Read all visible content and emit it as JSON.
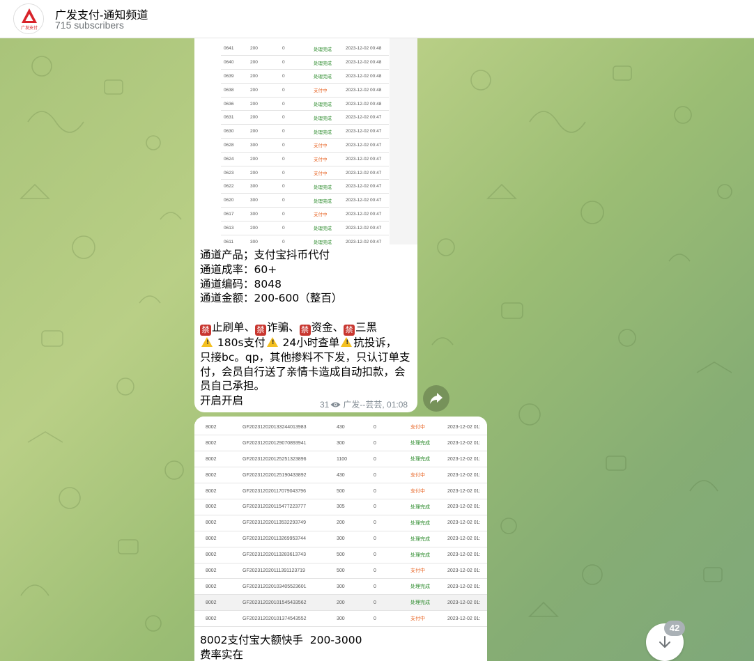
{
  "header": {
    "title": "广发支付-通知频道",
    "subscribers": "715 subscribers",
    "avatar_text": "广发支付"
  },
  "message1": {
    "table": [
      [
        "0641",
        "200",
        "0",
        "处理完成",
        "2023-12-02 00:48"
      ],
      [
        "0640",
        "200",
        "0",
        "处理完成",
        "2023-12-02 00:48"
      ],
      [
        "0639",
        "200",
        "0",
        "处理完成",
        "2023-12-02 00:48"
      ],
      [
        "0638",
        "200",
        "0",
        "支付中",
        "2023-12-02 00:48"
      ],
      [
        "0636",
        "200",
        "0",
        "处理完成",
        "2023-12-02 00:48"
      ],
      [
        "0631",
        "200",
        "0",
        "处理完成",
        "2023-12-02 00:47"
      ],
      [
        "0630",
        "200",
        "0",
        "处理完成",
        "2023-12-02 00:47"
      ],
      [
        "0628",
        "300",
        "0",
        "支付中",
        "2023-12-02 00:47"
      ],
      [
        "0624",
        "200",
        "0",
        "支付中",
        "2023-12-02 00:47"
      ],
      [
        "0623",
        "200",
        "0",
        "支付中",
        "2023-12-02 00:47"
      ],
      [
        "0622",
        "300",
        "0",
        "处理完成",
        "2023-12-02 00:47"
      ],
      [
        "0620",
        "300",
        "0",
        "处理完成",
        "2023-12-02 00:47"
      ],
      [
        "0617",
        "300",
        "0",
        "支付中",
        "2023-12-02 00:47"
      ],
      [
        "0613",
        "200",
        "0",
        "处理完成",
        "2023-12-02 00:47"
      ],
      [
        "0611",
        "300",
        "0",
        "处理完成",
        "2023-12-02 00:47"
      ]
    ],
    "text_lines": {
      "l1": "通道产品；支付宝抖币代付",
      "l2": "通道成率：60+",
      "l3": "通道编码：8048",
      "l4": "通道金额：200-600（整百）",
      "ban_char": "禁",
      "b1": "止刷单、",
      "b2": "诈骗、",
      "b3": "资金、",
      "b4": "三黑",
      "w1": " 180s支付",
      "w2": " 24小时查单",
      "w3": "抗投诉，",
      "l7": "只接bc。qp，其他掺料不下发，只认订单支付，会员自行送了亲情卡造成自动扣款，会员自己承担。",
      "l8": "开启开启"
    },
    "views": "31",
    "author_time": "广发--芸芸, 01:08"
  },
  "message2": {
    "table": [
      [
        "8002",
        "GF202312020133244013983",
        "430",
        "0",
        "支付中",
        "2023-12-02 01:"
      ],
      [
        "8002",
        "GF202312020129070893941",
        "300",
        "0",
        "处理完成",
        "2023-12-02 01:"
      ],
      [
        "8002",
        "GF202312020125251323896",
        "1100",
        "0",
        "处理完成",
        "2023-12-02 01:"
      ],
      [
        "8002",
        "GF202312020125190433892",
        "430",
        "0",
        "支付中",
        "2023-12-02 01:"
      ],
      [
        "8002",
        "GF202312020117079043796",
        "500",
        "0",
        "支付中",
        "2023-12-02 01:"
      ],
      [
        "8002",
        "GF202312020115477223777",
        "305",
        "0",
        "处理完成",
        "2023-12-02 01:"
      ],
      [
        "8002",
        "GF202312020113532293749",
        "200",
        "0",
        "处理完成",
        "2023-12-02 01:"
      ],
      [
        "8002",
        "GF202312020113269953744",
        "300",
        "0",
        "处理完成",
        "2023-12-02 01:"
      ],
      [
        "8002",
        "GF202312020113283613743",
        "500",
        "0",
        "处理完成",
        "2023-12-02 01:"
      ],
      [
        "8002",
        "GF202312020111391123719",
        "500",
        "0",
        "支付中",
        "2023-12-02 01:"
      ],
      [
        "8002",
        "GF202312020103405523601",
        "300",
        "0",
        "处理完成",
        "2023-12-02 01:"
      ],
      [
        "8002",
        "GF202312020101545433562",
        "200",
        "0",
        "处理完成",
        "2023-12-02 01:"
      ],
      [
        "8002",
        "GF202312020101374543552",
        "300",
        "0",
        "支付中",
        "2023-12-02 01:"
      ]
    ],
    "text": "8002支付宝大额快手  200-3000\n费率实在"
  },
  "scroll": {
    "unread": "42"
  },
  "colors": {
    "status_done": "#2a8a2a",
    "status_paying": "#e8682a",
    "ban_bg": "#c8362f",
    "warn": "#f4c020"
  }
}
